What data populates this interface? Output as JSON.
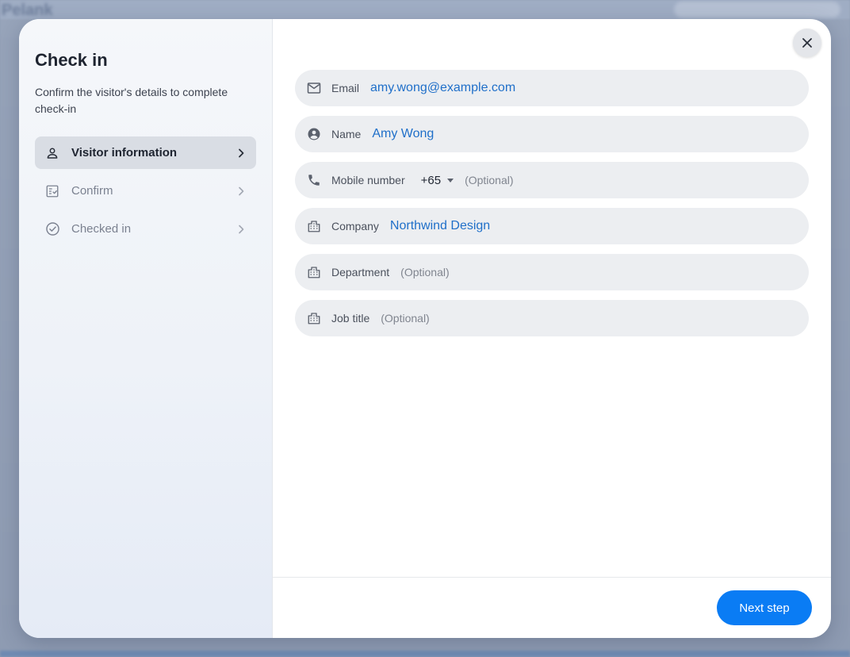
{
  "background": {
    "brand": "Pelank"
  },
  "modal": {
    "title": "Check in",
    "description": "Confirm the visitor's details to complete check-in",
    "steps": [
      {
        "label": "Visitor information",
        "icon": "person-icon",
        "active": true
      },
      {
        "label": "Confirm",
        "icon": "checklist-icon",
        "active": false
      },
      {
        "label": "Checked in",
        "icon": "check-circle-icon",
        "active": false
      }
    ]
  },
  "form": {
    "email": {
      "label": "Email",
      "value": "amy.wong@example.com",
      "icon": "mail-icon"
    },
    "name": {
      "label": "Name",
      "value": "Amy Wong",
      "icon": "account-circle-icon"
    },
    "mobile": {
      "label": "Mobile number",
      "country_code": "+65",
      "placeholder": "(Optional)",
      "icon": "phone-icon"
    },
    "company": {
      "label": "Company",
      "value": "Northwind Design",
      "icon": "building-icon"
    },
    "department": {
      "label": "Department",
      "placeholder": "(Optional)",
      "icon": "building-icon"
    },
    "job_title": {
      "label": "Job title",
      "placeholder": "(Optional)",
      "icon": "building-icon"
    }
  },
  "footer": {
    "next_label": "Next step"
  },
  "colors": {
    "accent": "#0a7cf4",
    "value_text": "#1f6fc9",
    "active_step_bg": "#d9dde4"
  }
}
